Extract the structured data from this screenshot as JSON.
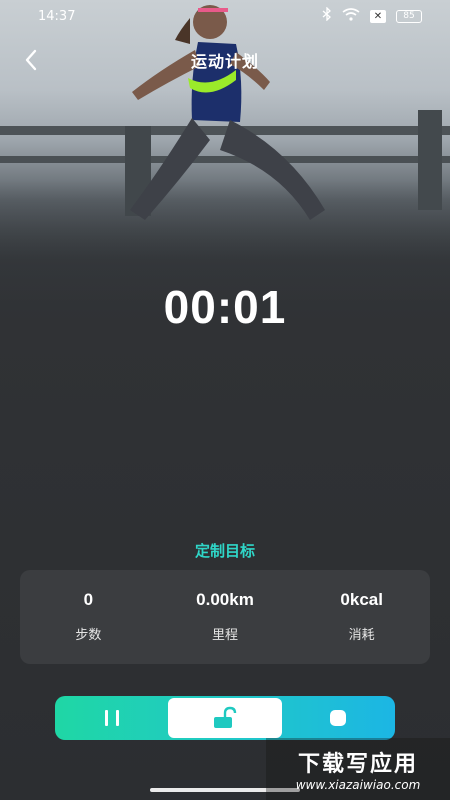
{
  "status_bar": {
    "time": "14:37",
    "battery": "85",
    "icons": [
      "bluetooth-icon",
      "wifi-icon",
      "sim-x-icon",
      "battery-icon"
    ]
  },
  "header": {
    "title": "运动计划"
  },
  "timer": "00:01",
  "goal_label": "定制目标",
  "stats": [
    {
      "value": "0",
      "label": "步数"
    },
    {
      "value": "0.00km",
      "label": "里程"
    },
    {
      "value": "0kcal",
      "label": "消耗"
    }
  ],
  "controls": {
    "pause_icon": "pause-icon",
    "lock_icon": "unlock-icon",
    "stop_icon": "stop-icon"
  },
  "colors": {
    "accent": "#2fd6c8",
    "gradient_start": "#1fd7a5",
    "gradient_end": "#1cb6e4",
    "card": "#3b3d40"
  },
  "watermark": {
    "text": "下载写应用",
    "url": "www.xiazaiwiao.com"
  }
}
